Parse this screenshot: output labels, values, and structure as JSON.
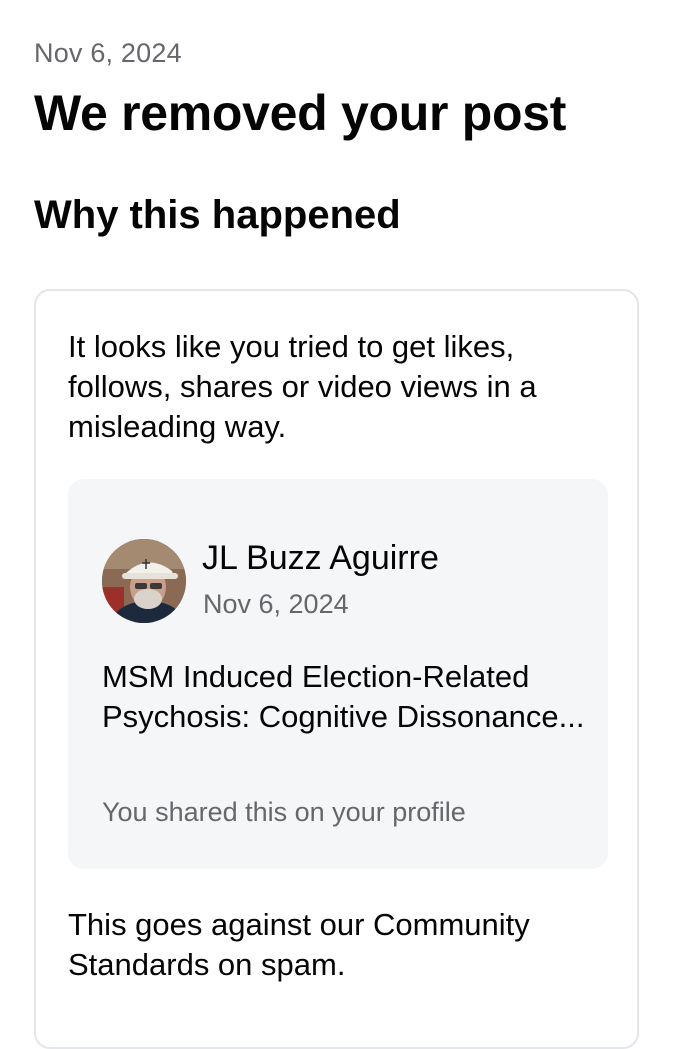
{
  "notice": {
    "date": "Nov 6, 2024",
    "title": "We removed your post",
    "section_title": "Why this happened"
  },
  "card": {
    "reason": "It looks like you tried to get likes, follows, shares or video views in a misleading way.",
    "standards": "This goes against our Community Standards on spam."
  },
  "post": {
    "author": "JL Buzz Aguirre",
    "date": "Nov 6, 2024",
    "text": "MSM Induced Election-Related Psychosis: Cognitive Dissonance...",
    "shared_note": "You shared this on your profile"
  },
  "colors": {
    "text_primary": "#050505",
    "text_secondary": "#65676b",
    "card_border": "#e4e6eb",
    "post_background": "#f5f6f8"
  }
}
